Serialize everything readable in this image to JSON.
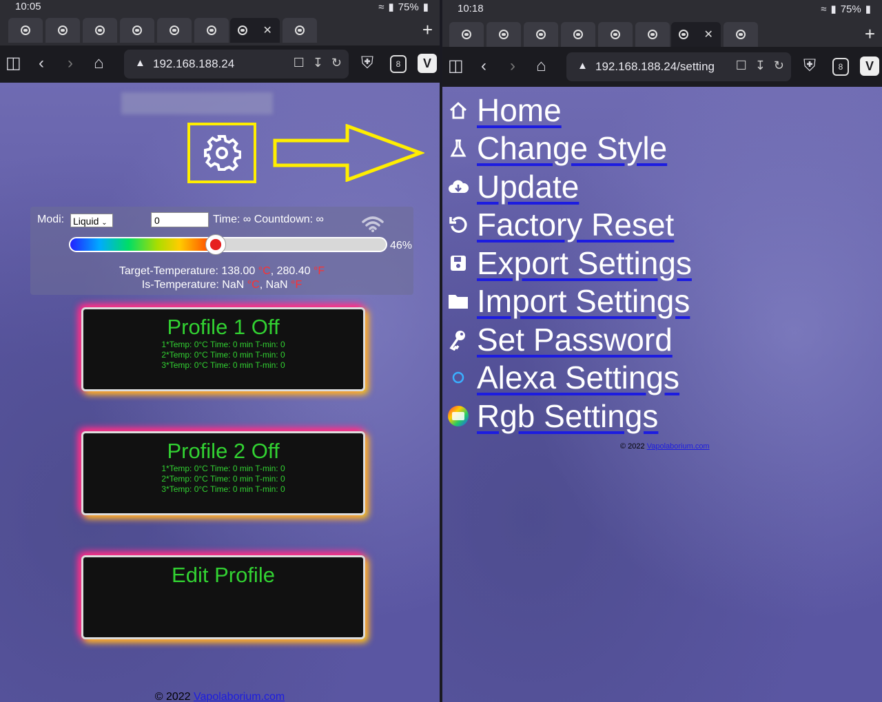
{
  "left": {
    "status": {
      "time": "10:05",
      "battery": "75%"
    },
    "url": "192.168.188.24",
    "tab_count": "8",
    "controls": {
      "modi_label": "Modi:",
      "modi_value": "Liquid",
      "number_value": "0",
      "time_countdown": "Time: ∞ Countdown: ∞",
      "percent": "46%",
      "slider_level": 0.46,
      "target_label": "Target-Temperature: 138.00",
      "target_c_unit": "°C",
      "target_f": ", 280.40",
      "target_f_unit": "°F",
      "is_label": "Is-Temperature: NaN",
      "is_c_unit": "°C",
      "is_f": ", NaN",
      "is_f_unit": "°F"
    },
    "profiles": [
      {
        "title": "Profile 1 Off",
        "lines": [
          "1*Temp: 0°C Time: 0 min T-min: 0",
          "2*Temp: 0°C Time: 0 min T-min: 0",
          "3*Temp: 0°C Time: 0 min T-min: 0"
        ]
      },
      {
        "title": "Profile 2 Off",
        "lines": [
          "1*Temp: 0°C Time: 0 min T-min: 0",
          "2*Temp: 0°C Time: 0 min T-min: 0",
          "3*Temp: 0°C Time: 0 min T-min: 0"
        ]
      },
      {
        "title": "Edit Profile",
        "lines": []
      }
    ],
    "footer_prefix": "© 2022 ",
    "footer_link": "Vapolaborium.com"
  },
  "right": {
    "status": {
      "time": "10:18",
      "battery": "75%"
    },
    "url": "192.168.188.24/setting",
    "tab_count": "8",
    "menu": [
      {
        "label": "Home",
        "icon": "home-icon"
      },
      {
        "label": "Change Style",
        "icon": "flask-icon"
      },
      {
        "label": "Update",
        "icon": "cloud-download-icon"
      },
      {
        "label": "Factory Reset",
        "icon": "reset-icon"
      },
      {
        "label": "Export Settings",
        "icon": "save-icon"
      },
      {
        "label": "Import Settings",
        "icon": "folder-icon"
      },
      {
        "label": "Set Password",
        "icon": "key-icon"
      },
      {
        "label": "Alexa Settings",
        "icon": "alexa-icon"
      },
      {
        "label": "Rgb Settings",
        "icon": "rgb-led-icon"
      }
    ],
    "footer_prefix": "© 2022 ",
    "footer_link": "Vapolaborium.com"
  },
  "colors": {
    "highlight": "#ffee00",
    "profile_text": "#32d232",
    "unit_red": "#ff3030",
    "link": "#1c1ce0"
  }
}
